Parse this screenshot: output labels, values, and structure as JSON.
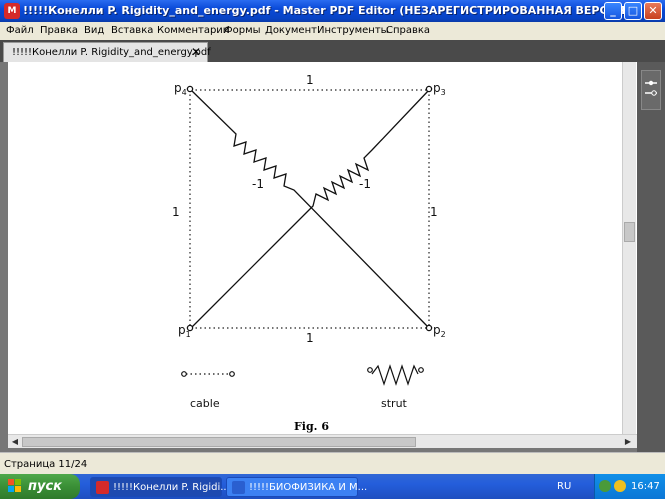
{
  "window": {
    "title": "!!!!!Конелли P. Rigidity_and_energy.pdf - Master PDF Editor (НЕЗАРЕГИСТРИРОВАННАЯ ВЕРСИЯ)",
    "minimize": "_",
    "maximize": "□",
    "close": "✕"
  },
  "menu": [
    "Файл",
    "Правка",
    "Вид",
    "Вставка",
    "Комментарии",
    "Формы",
    "Документ",
    "Инструменты",
    "Справка"
  ],
  "tabs": [
    {
      "label": "!!!!!Конелли P. Rigidity_and_energy.pdf",
      "close": "✕"
    }
  ],
  "figure": {
    "points": {
      "p1": "p",
      "p1_sub": "1",
      "p2": "p",
      "p2_sub": "2",
      "p3": "p",
      "p3_sub": "3",
      "p4": "p",
      "p4_sub": "4"
    },
    "edge_top": "1",
    "edge_bottom": "1",
    "edge_left": "1",
    "edge_right": "1",
    "strut_left_label": "-1",
    "strut_right_label": "-1",
    "legend_cable": "cable",
    "legend_strut": "strut",
    "caption": "Fig. 6"
  },
  "status": {
    "page": "Страница 11/24"
  },
  "taskbar": {
    "start": "пуск",
    "tasks": [
      {
        "label": "!!!!!Конелли P. Rigidi...",
        "color": "#d52a2a"
      },
      {
        "label": "!!!!!БИОФИЗИКА И М...",
        "color": "#2a5fd0"
      }
    ],
    "language": "RU",
    "clock": "16:47"
  }
}
